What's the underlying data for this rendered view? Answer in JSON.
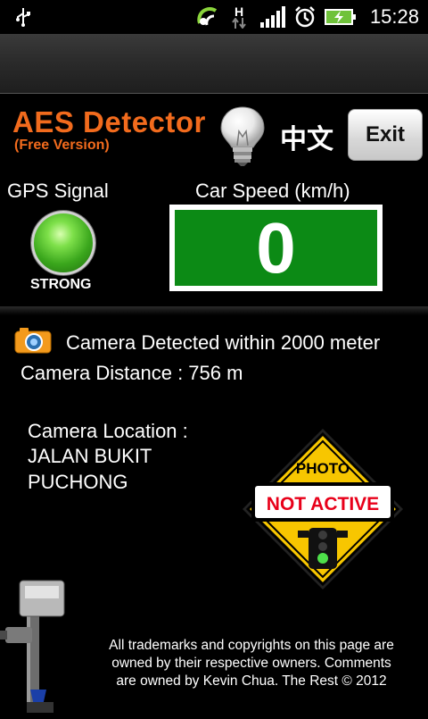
{
  "status_bar": {
    "time": "15:28",
    "icons": [
      "usb-icon",
      "sync-icon",
      "hspa-data-icon",
      "signal-icon",
      "alarm-icon",
      "battery-charging-icon"
    ],
    "network_letter": "H"
  },
  "header": {
    "title": "AES Detector",
    "subtitle": "(Free Version)",
    "language_toggle": "中文",
    "exit_label": "Exit"
  },
  "gps": {
    "label": "GPS Signal",
    "state": "STRONG",
    "indicator_color": "#3aa61c"
  },
  "speed": {
    "label": "Car Speed (km/h)",
    "value": "0",
    "panel_color": "#0c8a15"
  },
  "camera": {
    "detected_text": "Camera Detected within 2000 meter",
    "distance_text": "Camera Distance : 756 m",
    "location_label": "Camera Location :",
    "location_line1": "JALAN BUKIT",
    "location_line2": "PUCHONG"
  },
  "sign": {
    "top_text": "PHOTO",
    "status_text": "NOT ACTIVE",
    "sign_color": "#f7c600",
    "status_color": "#e8001a"
  },
  "footer": {
    "line1": "All trademarks and copyrights on this page are",
    "line2": "owned by their respective owners. Comments",
    "line3": "are owned by Kevin Chua. The Rest © 2012"
  },
  "accent_color": "#f26b1d"
}
